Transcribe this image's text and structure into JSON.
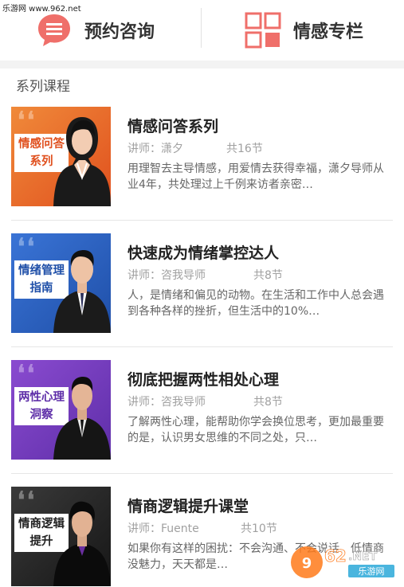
{
  "watermark": {
    "text": "乐游网 www.962.net"
  },
  "tabs": {
    "consult": {
      "label": "预约咨询",
      "icon": "chat-bubble-icon"
    },
    "column": {
      "label": "情感专栏",
      "icon": "grid-icon"
    }
  },
  "section": {
    "title": "系列课程"
  },
  "courses": [
    {
      "thumb_label_line1": "情感问答",
      "thumb_label_line2": "系列",
      "title": "情感问答系列",
      "teacher": "讲师：潇夕",
      "lessons": "共16节",
      "desc": "用理智去主导情感，用爱情去获得幸福，潇夕导师从业4年，共处理过上千例来访者亲密…",
      "theme": "#e8612a"
    },
    {
      "thumb_label_line1": "情绪管理",
      "thumb_label_line2": "指南",
      "title": "快速成为情绪掌控达人",
      "teacher": "讲师：咨我导师",
      "lessons": "共8节",
      "desc": "人，是情绪和偏见的动物。在生活和工作中人总会遇到各种各样的挫折，但生活中的10%…",
      "theme": "#2f62c4"
    },
    {
      "thumb_label_line1": "两性心理",
      "thumb_label_line2": "洞察",
      "title": "彻底把握两性相处心理",
      "teacher": "讲师：咨我导师",
      "lessons": "共8节",
      "desc": "了解两性心理，能帮助你学会换位思考，更加最重要的是，认识男女思维的不同之处，只…",
      "theme": "#7a3fc0"
    },
    {
      "thumb_label_line1": "情商逻辑",
      "thumb_label_line2": "提升",
      "title": "情商逻辑提升课堂",
      "teacher": "讲师：Fuente",
      "lessons": "共10节",
      "desc": "如果你有这样的困扰：不会沟通、不会说话、低情商没魅力，天天都是…",
      "theme": "#2a2a2a"
    }
  ],
  "bottom_watermark": {
    "line1": "962.NET",
    "line2": "乐游网"
  },
  "colors": {
    "accent": "#ef6f6a",
    "divider": "#e6e6e6",
    "band": "#f3f3f3"
  }
}
